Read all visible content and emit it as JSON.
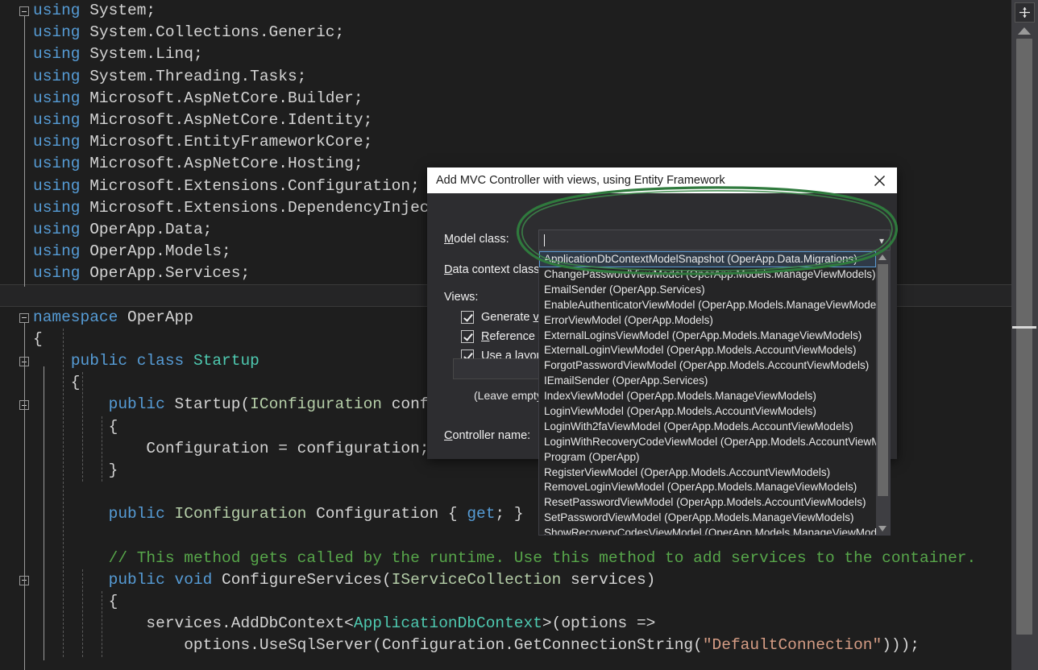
{
  "editor": {
    "language": "csharp",
    "lines": [
      {
        "fold": true,
        "indent": 0,
        "tokens": [
          {
            "t": "using",
            "c": "kw"
          },
          {
            "t": " System;",
            "c": "plain"
          }
        ]
      },
      {
        "fold": false,
        "indent": 0,
        "tokens": [
          {
            "t": "using",
            "c": "kw"
          },
          {
            "t": " System.Collections.Generic;",
            "c": "plain"
          }
        ]
      },
      {
        "fold": false,
        "indent": 0,
        "tokens": [
          {
            "t": "using",
            "c": "kw"
          },
          {
            "t": " System.Linq;",
            "c": "plain"
          }
        ]
      },
      {
        "fold": false,
        "indent": 0,
        "tokens": [
          {
            "t": "using",
            "c": "kw"
          },
          {
            "t": " System.Threading.Tasks;",
            "c": "plain"
          }
        ]
      },
      {
        "fold": false,
        "indent": 0,
        "tokens": [
          {
            "t": "using",
            "c": "kw"
          },
          {
            "t": " Microsoft.AspNetCore.Builder;",
            "c": "plain"
          }
        ]
      },
      {
        "fold": false,
        "indent": 0,
        "tokens": [
          {
            "t": "using",
            "c": "kw"
          },
          {
            "t": " Microsoft.AspNetCore.Identity;",
            "c": "plain"
          }
        ]
      },
      {
        "fold": false,
        "indent": 0,
        "tokens": [
          {
            "t": "using",
            "c": "kw"
          },
          {
            "t": " Microsoft.EntityFrameworkCore;",
            "c": "plain"
          }
        ]
      },
      {
        "fold": false,
        "indent": 0,
        "tokens": [
          {
            "t": "using",
            "c": "kw"
          },
          {
            "t": " Microsoft.AspNetCore.Hosting;",
            "c": "plain"
          }
        ]
      },
      {
        "fold": false,
        "indent": 0,
        "tokens": [
          {
            "t": "using",
            "c": "kw"
          },
          {
            "t": " Microsoft.Extensions.Configuration;",
            "c": "plain"
          }
        ]
      },
      {
        "fold": false,
        "indent": 0,
        "tokens": [
          {
            "t": "using",
            "c": "kw"
          },
          {
            "t": " Microsoft.Extensions.DependencyInjection;",
            "c": "plain"
          }
        ]
      },
      {
        "fold": false,
        "indent": 0,
        "tokens": [
          {
            "t": "using",
            "c": "kw"
          },
          {
            "t": " OperApp.Data;",
            "c": "plain"
          }
        ]
      },
      {
        "fold": false,
        "indent": 0,
        "tokens": [
          {
            "t": "using",
            "c": "kw"
          },
          {
            "t": " OperApp.Models;",
            "c": "plain"
          }
        ]
      },
      {
        "fold": false,
        "indent": 0,
        "tokens": [
          {
            "t": "using",
            "c": "kw"
          },
          {
            "t": " OperApp.Services;",
            "c": "plain"
          }
        ]
      },
      {
        "fold": false,
        "indent": 0,
        "current": true,
        "tokens": [
          {
            "t": "",
            "c": "plain"
          }
        ]
      },
      {
        "fold": true,
        "indent": 0,
        "tokens": [
          {
            "t": "namespace",
            "c": "kw"
          },
          {
            "t": " OperApp",
            "c": "plain"
          }
        ]
      },
      {
        "fold": false,
        "indent": 0,
        "tokens": [
          {
            "t": "{",
            "c": "plain"
          }
        ]
      },
      {
        "fold": true,
        "indent": 1,
        "tokens": [
          {
            "t": "    ",
            "c": "plain"
          },
          {
            "t": "public class",
            "c": "kw"
          },
          {
            "t": " ",
            "c": "plain"
          },
          {
            "t": "Startup",
            "c": "type"
          }
        ]
      },
      {
        "fold": false,
        "indent": 1,
        "tokens": [
          {
            "t": "    {",
            "c": "plain"
          }
        ]
      },
      {
        "fold": true,
        "indent": 2,
        "tokens": [
          {
            "t": "        ",
            "c": "plain"
          },
          {
            "t": "public",
            "c": "kw"
          },
          {
            "t": " Startup(",
            "c": "plain"
          },
          {
            "t": "IConfiguration",
            "c": "iface"
          },
          {
            "t": " configuration)",
            "c": "plain"
          }
        ]
      },
      {
        "fold": false,
        "indent": 2,
        "tokens": [
          {
            "t": "        {",
            "c": "plain"
          }
        ]
      },
      {
        "fold": false,
        "indent": 3,
        "tokens": [
          {
            "t": "            Configuration = configuration;",
            "c": "plain"
          }
        ]
      },
      {
        "fold": false,
        "indent": 2,
        "tokens": [
          {
            "t": "        }",
            "c": "plain"
          }
        ]
      },
      {
        "fold": false,
        "indent": 2,
        "tokens": [
          {
            "t": "",
            "c": "plain"
          }
        ]
      },
      {
        "fold": false,
        "indent": 2,
        "tokens": [
          {
            "t": "        ",
            "c": "plain"
          },
          {
            "t": "public",
            "c": "kw"
          },
          {
            "t": " ",
            "c": "plain"
          },
          {
            "t": "IConfiguration",
            "c": "iface"
          },
          {
            "t": " Configuration { ",
            "c": "plain"
          },
          {
            "t": "get",
            "c": "kw"
          },
          {
            "t": "; }",
            "c": "plain"
          }
        ]
      },
      {
        "fold": false,
        "indent": 2,
        "tokens": [
          {
            "t": "",
            "c": "plain"
          }
        ]
      },
      {
        "fold": false,
        "indent": 2,
        "tokens": [
          {
            "t": "        ",
            "c": "plain"
          },
          {
            "t": "// This method gets called by the runtime. Use this method to add services to the container.",
            "c": "cmt"
          }
        ]
      },
      {
        "fold": true,
        "indent": 2,
        "tokens": [
          {
            "t": "        ",
            "c": "plain"
          },
          {
            "t": "public void",
            "c": "kw"
          },
          {
            "t": " ConfigureServices(",
            "c": "plain"
          },
          {
            "t": "IServiceCollection",
            "c": "iface"
          },
          {
            "t": " services)",
            "c": "plain"
          }
        ]
      },
      {
        "fold": false,
        "indent": 2,
        "tokens": [
          {
            "t": "        {",
            "c": "plain"
          }
        ]
      },
      {
        "fold": false,
        "indent": 3,
        "tokens": [
          {
            "t": "            services.AddDbContext<",
            "c": "plain"
          },
          {
            "t": "ApplicationDbContext",
            "c": "type"
          },
          {
            "t": ">(options =>",
            "c": "plain"
          }
        ]
      },
      {
        "fold": false,
        "indent": 3,
        "tokens": [
          {
            "t": "                options.UseSqlServer(Configuration.GetConnectionString(",
            "c": "plain"
          },
          {
            "t": "\"DefaultConnection\"",
            "c": "str"
          },
          {
            "t": ")));",
            "c": "plain"
          }
        ]
      }
    ]
  },
  "scrollbar": {
    "split_view_icon": "split-view-icon",
    "up_arrow_icon": "scroll-up-arrow-icon"
  },
  "dialog": {
    "title": "Add MVC Controller with views, using Entity Framework",
    "close_icon": "close-icon",
    "labels": {
      "model_class": "Model class:",
      "model_class_mnemonic": "M",
      "data_context_class": "Data context class:",
      "data_context_mnemonic": "D",
      "views": "Views:",
      "controller_name": "Controller name:",
      "controller_name_mnemonic": "C",
      "leave_empty_hint": "(Leave empty if it is"
    },
    "checkboxes": [
      {
        "label_pre": "Generate ",
        "mnemonic": "v",
        "label_post": "iews",
        "checked": true,
        "name": "generate-views"
      },
      {
        "label_pre": "",
        "mnemonic": "R",
        "label_post": "eference script libr",
        "checked": true,
        "name": "reference-script-libraries"
      },
      {
        "label_pre": "",
        "mnemonic": "U",
        "label_post": "se a layout page:",
        "checked": true,
        "name": "use-a-layout-page"
      }
    ],
    "model_combo": {
      "value": "",
      "chevron_icon": "chevron-down-icon"
    },
    "dropdown": {
      "selected_index": 0,
      "items": [
        "ApplicationDbContextModelSnapshot (OperApp.Data.Migrations)",
        "ChangePasswordViewModel (OperApp.Models.ManageViewModels)",
        "EmailSender (OperApp.Services)",
        "EnableAuthenticatorViewModel (OperApp.Models.ManageViewModels)",
        "ErrorViewModel (OperApp.Models)",
        "ExternalLoginsViewModel (OperApp.Models.ManageViewModels)",
        "ExternalLoginViewModel (OperApp.Models.AccountViewModels)",
        "ForgotPasswordViewModel (OperApp.Models.AccountViewModels)",
        "IEmailSender (OperApp.Services)",
        "IndexViewModel (OperApp.Models.ManageViewModels)",
        "LoginViewModel (OperApp.Models.AccountViewModels)",
        "LoginWith2faViewModel (OperApp.Models.AccountViewModels)",
        "LoginWithRecoveryCodeViewModel (OperApp.Models.AccountViewModels)",
        "Program (OperApp)",
        "RegisterViewModel (OperApp.Models.AccountViewModels)",
        "RemoveLoginViewModel (OperApp.Models.ManageViewModels)",
        "ResetPasswordViewModel (OperApp.Models.AccountViewModels)",
        "SetPasswordViewModel (OperApp.Models.ManageViewModels)",
        "ShowRecoveryCodesViewModel (OperApp.Models.ManageViewModels)"
      ],
      "scroll_up_icon": "scroll-up-arrow-icon",
      "scroll_down_icon": "scroll-down-arrow-icon"
    }
  },
  "annotation": {
    "type": "hand-drawn-ellipse",
    "color": "#2f7a3d"
  },
  "colors": {
    "editor_background": "#1e1e1e",
    "keyword": "#569cd6",
    "type": "#4ec9b0",
    "interface": "#b5cea8",
    "comment": "#57a64a",
    "string": "#d69d85",
    "dialog_background": "#2d2d30",
    "dialog_titlebar": "#ffffff",
    "selection_border": "#5a9bd4",
    "annotation_green": "#2f7a3d"
  }
}
